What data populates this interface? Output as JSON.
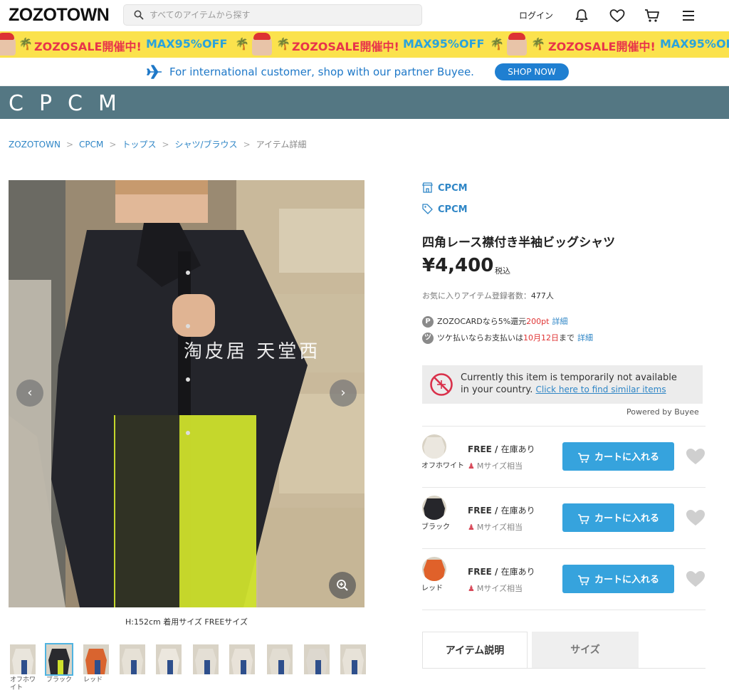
{
  "header": {
    "logo": "ZOZOTOWN",
    "search_placeholder": "すべてのアイテムから探す",
    "login": "ログイン"
  },
  "sale_banner": {
    "text": "ZOZOSALE開催中!",
    "max": "MAX95%OFF"
  },
  "buyee": {
    "text": "For international customer, shop with our partner Buyee.",
    "button": "SHOP NOW"
  },
  "brand": {
    "logo": "CPCM"
  },
  "breadcrumb": [
    "ZOZOTOWN",
    "CPCM",
    "トップス",
    "シャツ/ブラウス",
    "アイテム詳細"
  ],
  "gallery": {
    "watermark": "淘皮居 天堂西",
    "caption": "H:152cm 着用サイズ FREEサイズ",
    "thumbnails": [
      {
        "label": "オフホワイト",
        "color": "#e9e5dc"
      },
      {
        "label": "ブラック",
        "color": "#2a2a2e"
      },
      {
        "label": "レッド",
        "color": "#d9642f"
      },
      {
        "label": "",
        "color": "#e6e1d6"
      },
      {
        "label": "",
        "color": "#ece7de"
      },
      {
        "label": "",
        "color": "#e4dfd5"
      },
      {
        "label": "",
        "color": "#e8e2d8"
      },
      {
        "label": "",
        "color": "#e2ddd2"
      },
      {
        "label": "",
        "color": "#ddd8cf"
      },
      {
        "label": "",
        "color": "#e7e2d8"
      }
    ]
  },
  "product": {
    "shop": "CPCM",
    "brand": "CPCM",
    "title": "四角レース襟付き半袖ビッグシャツ",
    "price": "¥4,400",
    "tax": "税込",
    "favorites_label": "お気に入りアイテム登録者数：",
    "favorites_count": "477人",
    "zozocard_prefix": "ZOZOCARDなら5%還元",
    "zozocard_points": "200pt",
    "detail_link": "詳細",
    "tsuke_prefix": "ツケ払いならお支払いは",
    "tsuke_date": "10月12日",
    "tsuke_suffix": "まで",
    "detail_link2": "詳細"
  },
  "notice": {
    "line1": "Currently this item is temporarily not available",
    "line2_prefix": "in your country.",
    "link": "Click here to find similar items",
    "powered": "Powered by Buyee"
  },
  "variants": [
    {
      "color_name": "オフホワイト",
      "size": "FREE",
      "stock": "在庫あり",
      "hint": "Mサイズ相当",
      "cart": "カートに入れる",
      "swatch": "#ebe7df"
    },
    {
      "color_name": "ブラック",
      "size": "FREE",
      "stock": "在庫あり",
      "hint": "Mサイズ相当",
      "cart": "カートに入れる",
      "swatch": "#26262b"
    },
    {
      "color_name": "レッド",
      "size": "FREE",
      "stock": "在庫あり",
      "hint": "Mサイズ相当",
      "cart": "カートに入れる",
      "swatch": "#e0612a"
    }
  ],
  "tabs": [
    "アイテム説明",
    "サイズ"
  ],
  "colors": {
    "link": "#2f86c6",
    "cart": "#36a3dd",
    "brand_bar": "#547783",
    "sale": "#fbe24d"
  }
}
